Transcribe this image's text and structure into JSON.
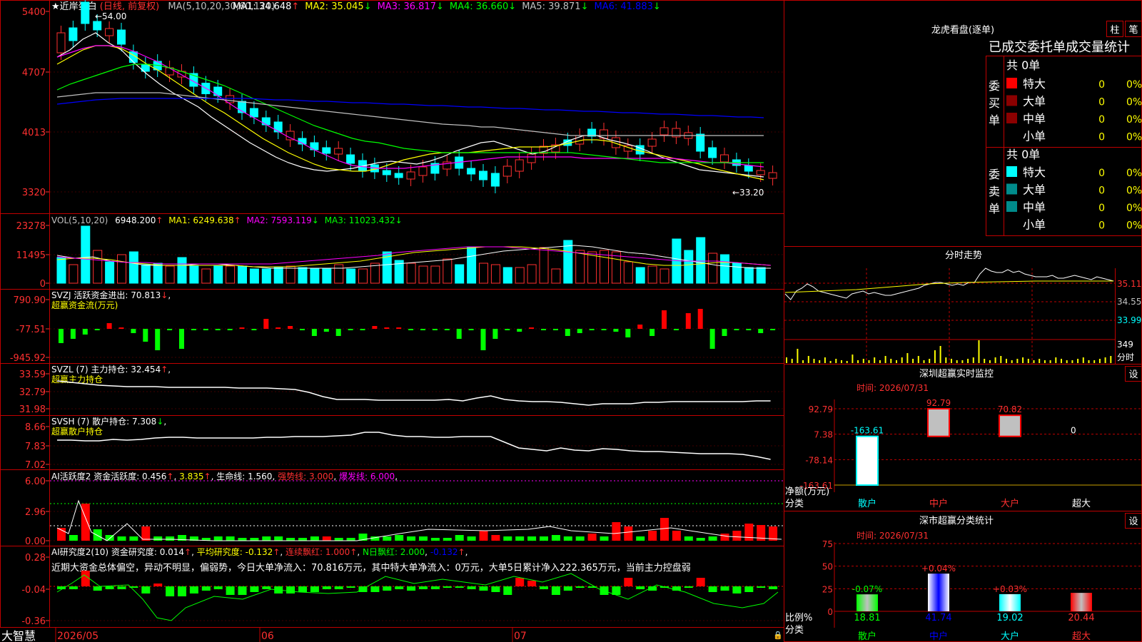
{
  "main": {
    "title_prefix": "★近岸蛋白",
    "period": "(日线, 前复权)",
    "ma_label": "MA(5,10,20,30,60,120)",
    "ma": [
      {
        "label": "MA1: 34.648",
        "arrow": "↑",
        "color": "#ffffff"
      },
      {
        "label": "MA2: 35.045",
        "arrow": "↓",
        "color": "#ffff00"
      },
      {
        "label": "MA3: 36.817",
        "arrow": "↓",
        "color": "#ff00ff"
      },
      {
        "label": "MA4: 36.660",
        "arrow": "↓",
        "color": "#00ff00"
      },
      {
        "label": "MA5: 39.871",
        "arrow": "↓",
        "color": "#c0c0c0"
      },
      {
        "label": "MA6: 41.883",
        "arrow": "↓",
        "color": "#0000ff"
      }
    ],
    "yticks": [
      "5400",
      "4707",
      "4013",
      "3320"
    ],
    "high_label": "←54.00",
    "low_label": "←33.20"
  },
  "vol": {
    "label": "VOL(5,10,20)",
    "value": "6948.200",
    "ma1": "MA1: 6249.638",
    "ma2": "MA2: 7593.119",
    "ma3": "MA3: 11023.432",
    "yticks": [
      "23278",
      "11495",
      "0"
    ]
  },
  "svzj": {
    "label": "SVZJ  活跃资金进出: 70.813",
    "sub": "超赢资金流(万元)",
    "yticks": [
      "790.90",
      "-77.51",
      "-945.92"
    ]
  },
  "svzl": {
    "label": "SVZL (7) 主力持仓: 32.454",
    "sub": "超赢主力持仓",
    "yticks": [
      "33.59",
      "32.79",
      "31.98"
    ]
  },
  "svsh": {
    "label": "SVSH (7) 散户持仓: 7.308",
    "sub": "超赢散户持仓",
    "yticks": [
      "8.66",
      "7.83",
      "7.02"
    ]
  },
  "ai1": {
    "label_a": "AI活跃度2 资金活跃度: 0.456",
    "label_b": "3.835",
    "label_c": "生命线: 1.560",
    "label_d": "强势线: 3.000",
    "label_e": "爆发线: 6.000",
    "yticks": [
      "6.00",
      "2.96",
      "0.00"
    ]
  },
  "ai2": {
    "label_a": "AI研究度2(10) 资金研究度: 0.014",
    "label_b": "平均研究度: -0.132",
    "label_c": "连续飘红: 1.000",
    "label_d": "N日飘红: 2.000",
    "label_e": "-0.132",
    "commentary": "近期大资金总体偏空，异动不明显，偏弱势，今日大单净流入：70.816万元，其中特大单净流入：0万元，大单5日累计净入222.365万元，当前主力控盘弱",
    "yticks": [
      "0.28",
      "-0.04",
      "-0.36"
    ]
  },
  "footer": {
    "brand": "大智慧",
    "dates": [
      "2026/05",
      "06",
      "07"
    ]
  },
  "right": {
    "lhkp_title": "龙虎看盘(逐单)",
    "btn_a": "柱",
    "btn_b": "笔",
    "lhkp_header": "已成交委托单成交量统计",
    "buy_label": "委买单",
    "sell_label": "委卖单",
    "buy_total": "共 0单",
    "sell_total": "共 0单",
    "rows": [
      {
        "name": "特大",
        "count": "0",
        "pct": "0%"
      },
      {
        "name": "大单",
        "count": "0",
        "pct": "0%"
      },
      {
        "name": "中单",
        "count": "0",
        "pct": "0%"
      },
      {
        "name": "小单",
        "count": "0",
        "pct": "0%"
      }
    ],
    "fs_title": "分时走势",
    "fs_yticks": [
      "35.11",
      "34.55",
      "33.99"
    ],
    "fs_vol": "349",
    "fs_vol_label": "分时",
    "monitor_title": "深圳超赢实时监控",
    "monitor_btn": "设",
    "monitor_time": "时间: 2026/07/31",
    "monitor_yticks": [
      "92.79",
      "7.38",
      "-78.14",
      "-163.61"
    ],
    "monitor_axis_a": "净额(万元)",
    "monitor_axis_b": "分类",
    "stat_title": "深市超赢分类统计",
    "stat_btn": "设",
    "stat_time": "时间: 2026/07/31",
    "stat_yticks": [
      "75",
      "50",
      "25",
      "0"
    ],
    "stat_axis_a": "比例%",
    "stat_axis_b": "分类",
    "categories": [
      "散户",
      "中户",
      "大户",
      "超大"
    ]
  },
  "chart_data": [
    {
      "type": "bar",
      "title": "深圳超赢实时监控",
      "ylabel": "净额(万元)",
      "categories": [
        "散户",
        "中户",
        "大户",
        "超大"
      ],
      "values": [
        -163.61,
        92.79,
        70.82,
        0
      ],
      "value_labels": [
        "-163.61",
        "92.79",
        "70.82",
        "0"
      ],
      "ylim": [
        -163.61,
        92.79
      ]
    },
    {
      "type": "bar",
      "title": "深市超赢分类统计",
      "ylabel": "比例%",
      "categories": [
        "散户",
        "中户",
        "大户",
        "超大"
      ],
      "values": [
        18.81,
        41.74,
        19.02,
        20.44
      ],
      "change_labels": [
        "-0.07%",
        "+0.04%",
        "+0.03%",
        ""
      ],
      "ylim": [
        0,
        75
      ]
    }
  ]
}
